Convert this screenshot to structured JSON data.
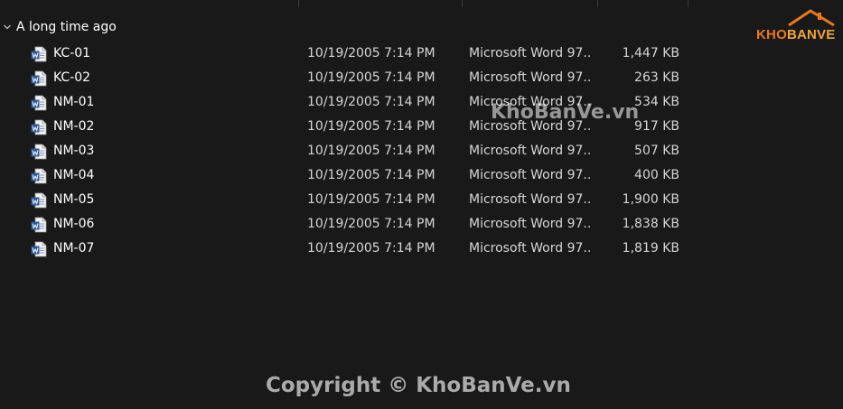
{
  "header": {
    "sort_indicator": "^"
  },
  "group": {
    "title": "A long time ago"
  },
  "files": [
    {
      "name": "KC-01",
      "date": "10/19/2005 7:14 PM",
      "type": "Microsoft Word 97...",
      "size": "1,447 KB"
    },
    {
      "name": "KC-02",
      "date": "10/19/2005 7:14 PM",
      "type": "Microsoft Word 97...",
      "size": "263 KB"
    },
    {
      "name": "NM-01",
      "date": "10/19/2005 7:14 PM",
      "type": "Microsoft Word 97...",
      "size": "534 KB"
    },
    {
      "name": "NM-02",
      "date": "10/19/2005 7:14 PM",
      "type": "Microsoft Word 97...",
      "size": "917 KB"
    },
    {
      "name": "NM-03",
      "date": "10/19/2005 7:14 PM",
      "type": "Microsoft Word 97...",
      "size": "507 KB"
    },
    {
      "name": "NM-04",
      "date": "10/19/2005 7:14 PM",
      "type": "Microsoft Word 97...",
      "size": "400 KB"
    },
    {
      "name": "NM-05",
      "date": "10/19/2005 7:14 PM",
      "type": "Microsoft Word 97...",
      "size": "1,900 KB"
    },
    {
      "name": "NM-06",
      "date": "10/19/2005 7:14 PM",
      "type": "Microsoft Word 97...",
      "size": "1,838 KB"
    },
    {
      "name": "NM-07",
      "date": "10/19/2005 7:14 PM",
      "type": "Microsoft Word 97...",
      "size": "1,819 KB"
    }
  ],
  "icons": {
    "file_icon": "word-document-icon",
    "group_toggle": "chevron-down-icon"
  },
  "watermarks": {
    "center": "KhoBanVe.vn",
    "bottom": "Copyright © KhoBanVe.vn",
    "logo_part1": "KHO",
    "logo_part2": "BANVE"
  },
  "colors": {
    "background": "#191919",
    "word_blue": "#2b579a",
    "logo_orange": "#e9781f"
  }
}
